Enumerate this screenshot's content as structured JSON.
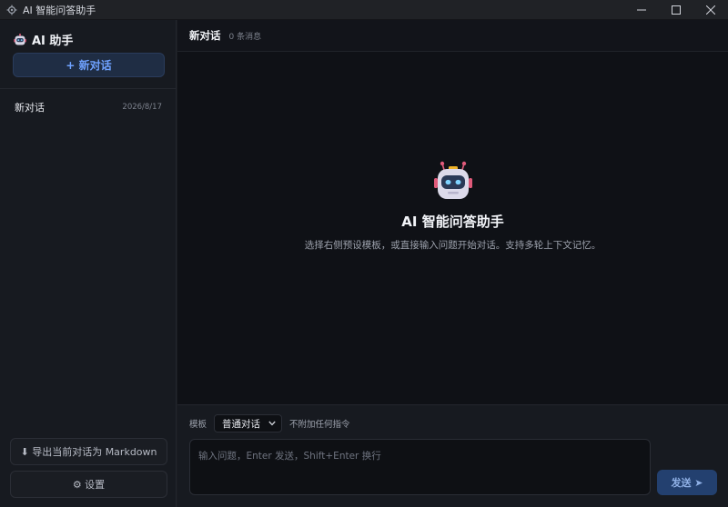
{
  "window": {
    "title": "AI 智能问答助手",
    "icon": "gear-icon"
  },
  "sidebar": {
    "brand_label": "AI 助手",
    "brand_icon": "robot-icon",
    "new_chat_label": "+ 新对话",
    "conversations": [
      {
        "name": "新对话",
        "date": "2026/8/17"
      }
    ],
    "export_label": "⬇ 导出当前对话为 Markdown",
    "settings_label": "⚙ 设置"
  },
  "main": {
    "title": "新对话",
    "message_count": "0 条消息",
    "empty_state": {
      "heading": "AI 智能问答助手",
      "description": "选择右侧预设模板，或直接输入问题开始对话。支持多轮上下文记忆。"
    }
  },
  "composer": {
    "template_label": "模板",
    "template_value": "普通对话",
    "template_hint": "不附加任何指令",
    "input_placeholder": "输入问题，Enter 发送，Shift+Enter 换行",
    "send_label": "发送 ➤"
  },
  "colors": {
    "accent": "#6fa2ff",
    "send_bg": "#23406f",
    "sidebar_bg": "#171a20",
    "main_bg": "#0f1116"
  }
}
